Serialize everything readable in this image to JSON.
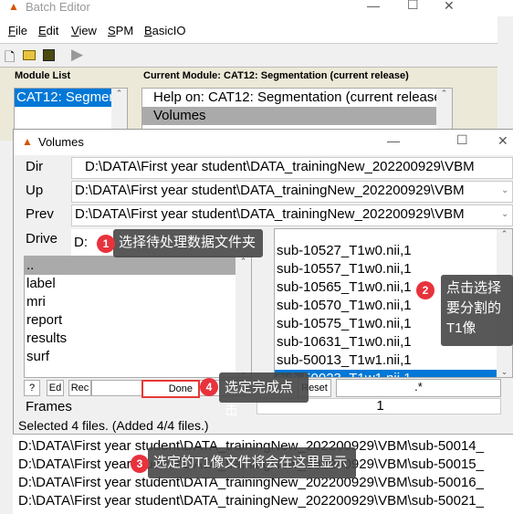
{
  "batch_editor": {
    "title": "Batch Editor",
    "menu": [
      "File",
      "Edit",
      "View",
      "SPM",
      "BasicIO"
    ],
    "module_list_label": "Module List",
    "module_list_items": [
      "CAT12: Segmer"
    ],
    "current_module_label": "Current Module: CAT12: Segmentation (current release)",
    "current_module_items": [
      "Help on: CAT12: Segmentation (current release)",
      "Volumes"
    ]
  },
  "volumes": {
    "title": "Volumes",
    "dir_label": "Dir",
    "dir_value": "D:\\DATA\\First year student\\DATA_trainingNew_202200929\\VBM",
    "up_label": "Up",
    "up_value": "D:\\DATA\\First year student\\DATA_trainingNew_202200929\\VBM",
    "prev_label": "Prev",
    "prev_value": "D:\\DATA\\First year student\\DATA_trainingNew_202200929\\VBM",
    "drive_label": "Drive",
    "drive_value": "D:",
    "dirs": [
      "..",
      "label",
      "mri",
      "report",
      "results",
      "surf"
    ],
    "files": [
      "sub-10527_T1w0.nii,1",
      "sub-10557_T1w0.nii,1",
      "sub-10565_T1w0.nii,1",
      "sub-10570_T1w0.nii,1",
      "sub-10575_T1w0.nii,1",
      "sub-10631_T1w0.nii,1",
      "sub-50013_T1w1.nii,1",
      "sub-50023_T1w1.nii,1"
    ],
    "buttons": {
      "help": "?",
      "ed": "Ed",
      "rec": "Rec",
      "done": "Done",
      "reset": "Reset"
    },
    "filter_value": ".*",
    "frames_label": "Frames",
    "frames_value": "1",
    "status": "Selected 4 files. (Added 4/4 files.)",
    "selected": [
      "D:\\DATA\\First year student\\DATA_trainingNew_202200929\\VBM\\sub-50014_",
      "D:\\DATA\\First year student\\DATA_trainingNew_202200929\\VBM\\sub-50015_",
      "D:\\DATA\\First year student\\DATA_trainingNew_202200929\\VBM\\sub-50016_",
      "D:\\DATA\\First year student\\DATA_trainingNew_202200929\\VBM\\sub-50021_"
    ]
  },
  "annotations": [
    {
      "n": "1",
      "text": "选择待处理数据文件夹"
    },
    {
      "n": "2",
      "text": "点击选择要分割的T1像"
    },
    {
      "n": "3",
      "text": "选定的T1像文件将会在这里显示"
    },
    {
      "n": "4",
      "text": "选定完成点击"
    }
  ],
  "colors": {
    "selection": "#0078d7",
    "badge": "#e8323c",
    "highlight_box": "#e53935"
  }
}
